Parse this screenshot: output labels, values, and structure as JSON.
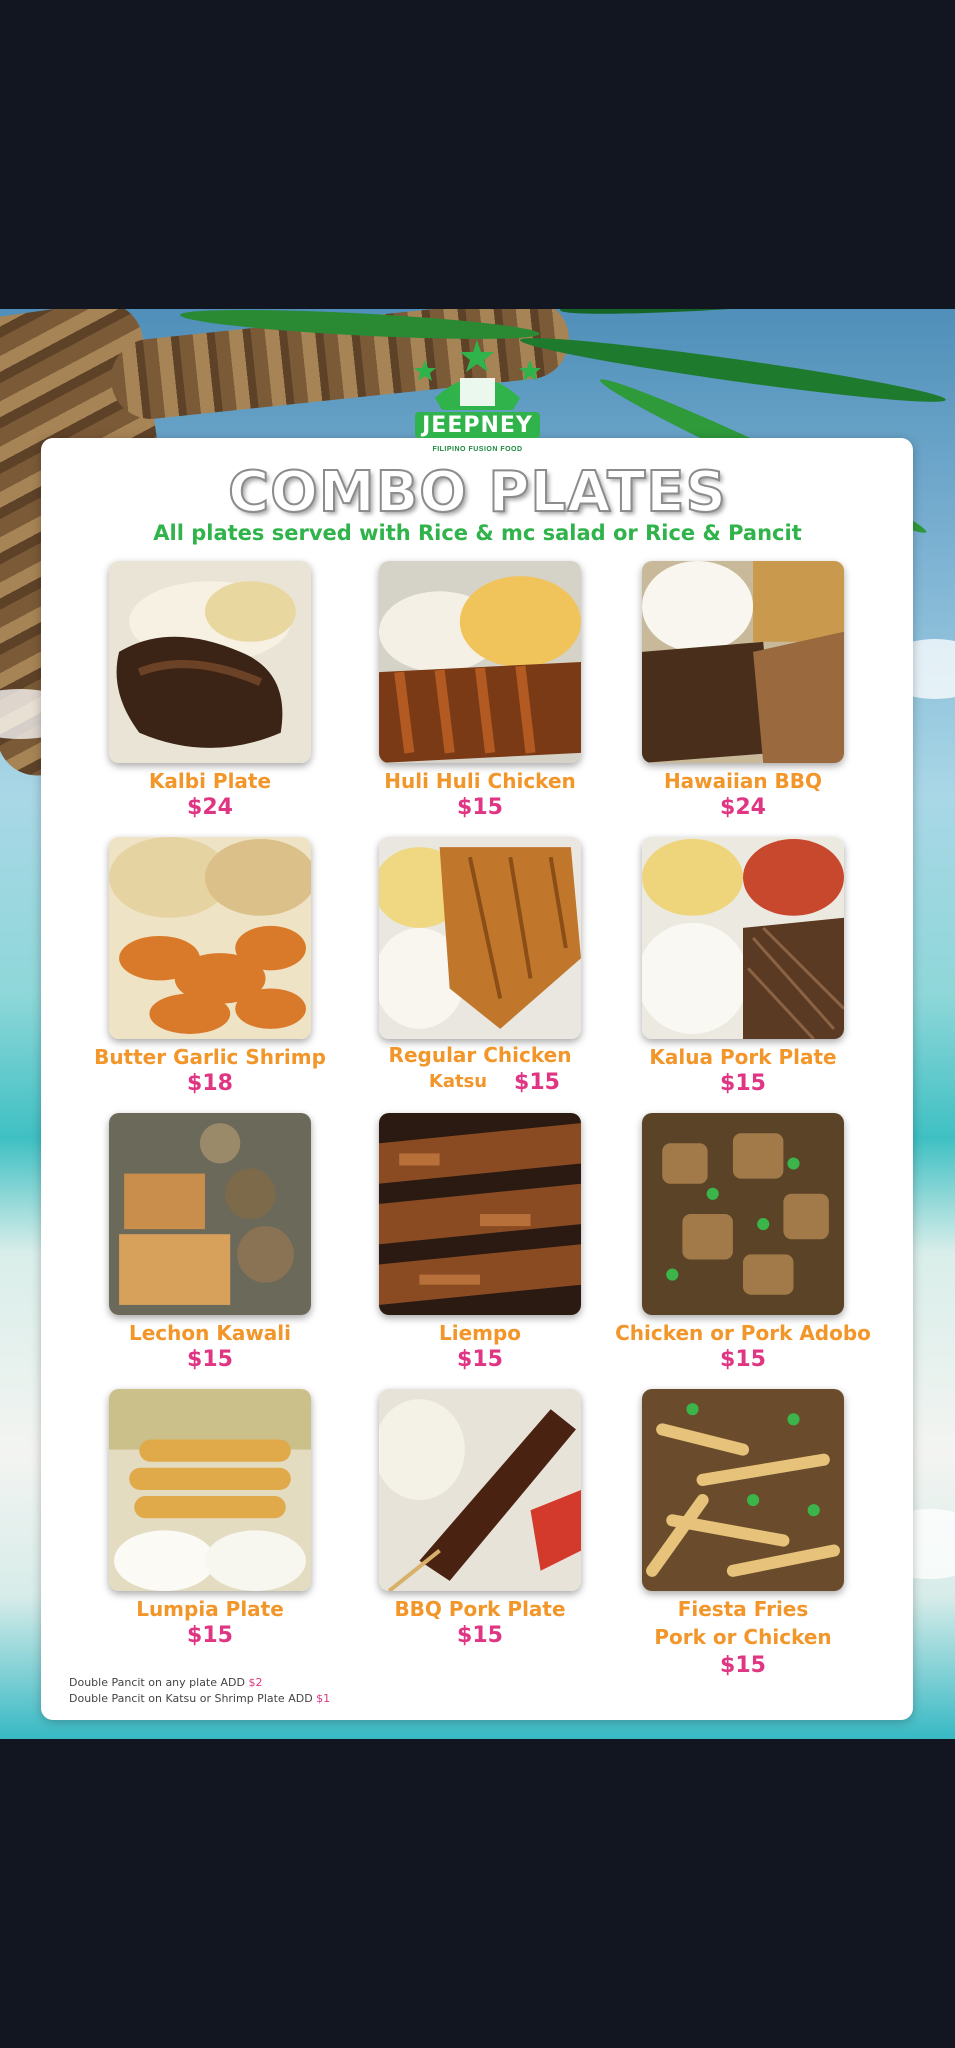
{
  "brand": {
    "name": "JEEPNEY",
    "tagline": "FILIPINO FUSION FOOD",
    "colors": {
      "green": "#2fb34a",
      "orange": "#f2962a",
      "pink": "#e03582"
    }
  },
  "menu": {
    "title": "COMBO PLATES",
    "subtitle": "All plates served with Rice & mc salad or Rice & Pancit",
    "items": [
      {
        "name": "Kalbi Plate",
        "price": "$24"
      },
      {
        "name": "Huli Huli Chicken",
        "price": "$15"
      },
      {
        "name": "Hawaiian BBQ",
        "price": "$24"
      },
      {
        "name": "Butter Garlic Shrimp",
        "price": "$18"
      },
      {
        "name": "Regular Chicken",
        "name2": "Katsu",
        "price": "$15"
      },
      {
        "name": "Kalua Pork Plate",
        "price": "$15"
      },
      {
        "name": "Lechon Kawali",
        "price": "$15"
      },
      {
        "name": "Liempo",
        "price": "$15"
      },
      {
        "name": "Chicken or Pork Adobo",
        "price": "$15"
      },
      {
        "name": "Lumpia Plate",
        "price": "$15"
      },
      {
        "name": "BBQ Pork Plate",
        "price": "$15"
      },
      {
        "name": "Fiesta Fries",
        "name2": "Pork or Chicken",
        "price": "$15"
      }
    ],
    "footnotes": [
      {
        "text": "Double Pancit on any plate ADD ",
        "amount": "$2"
      },
      {
        "text": "Double Pancit on Katsu or Shrimp Plate ADD ",
        "amount": "$1"
      }
    ]
  }
}
